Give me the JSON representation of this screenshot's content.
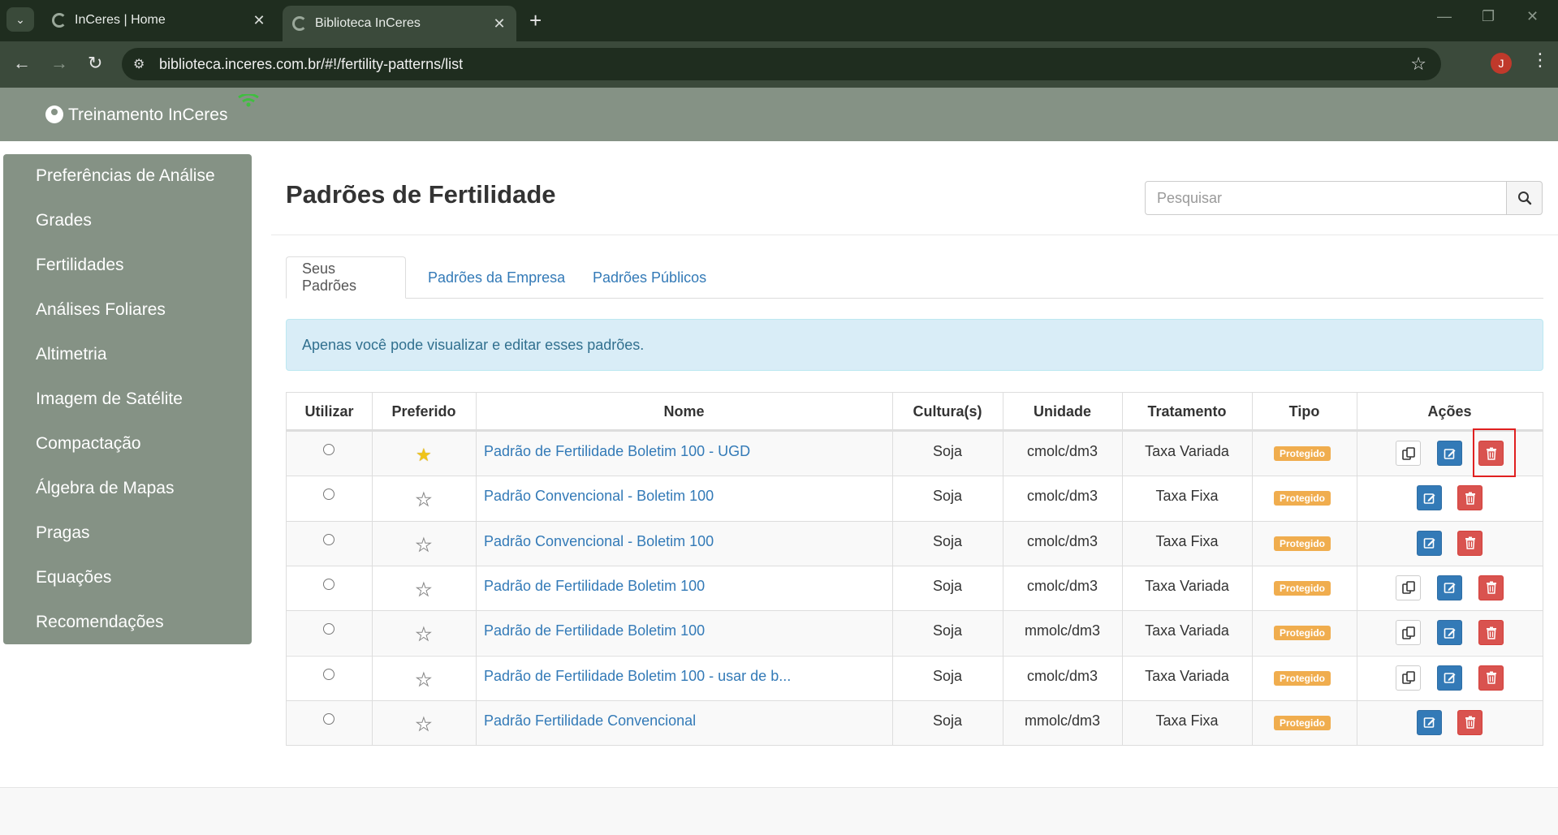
{
  "browser": {
    "tabs": [
      {
        "title": "InCeres | Home",
        "active": false
      },
      {
        "title": "Biblioteca InCeres",
        "active": true
      }
    ],
    "url": "biblioteca.inceres.com.br/#!/fertility-patterns/list",
    "profile_initial": "J",
    "minimize": "—",
    "restore": "❐",
    "close": "✕"
  },
  "header": {
    "user": "Treinamento InCeres"
  },
  "sidebar": {
    "items": [
      {
        "label": "Preferências de Análise"
      },
      {
        "label": "Grades"
      },
      {
        "label": "Fertilidades"
      },
      {
        "label": "Análises Foliares"
      },
      {
        "label": "Altimetria"
      },
      {
        "label": "Imagem de Satélite"
      },
      {
        "label": "Compactação"
      },
      {
        "label": "Álgebra de Mapas"
      },
      {
        "label": "Pragas"
      },
      {
        "label": "Equações"
      },
      {
        "label": "Recomendações"
      }
    ]
  },
  "main": {
    "title": "Padrões de Fertilidade",
    "search_placeholder": "Pesquisar",
    "tabs": [
      {
        "label": "Seus Padrões",
        "active": true
      },
      {
        "label": "Padrões da Empresa",
        "active": false
      },
      {
        "label": "Padrões Públicos",
        "active": false
      }
    ],
    "alert": "Apenas você pode visualizar e editar esses padrões."
  },
  "table": {
    "columns": [
      "Utilizar",
      "Preferido",
      "Nome",
      "Cultura(s)",
      "Unidade",
      "Tratamento",
      "Tipo",
      "Ações"
    ],
    "rows": [
      {
        "name": "Padrão de Fertilidade Boletim 100 - UGD",
        "culture": "Soja",
        "unit": "cmolc/dm3",
        "treatment": "Taxa Variada",
        "type": "Protegido",
        "preferred": true,
        "copy": true
      },
      {
        "name": "Padrão Convencional - Boletim 100",
        "culture": "Soja",
        "unit": "cmolc/dm3",
        "treatment": "Taxa Fixa",
        "type": "Protegido",
        "preferred": false,
        "copy": false
      },
      {
        "name": "Padrão Convencional - Boletim 100",
        "culture": "Soja",
        "unit": "cmolc/dm3",
        "treatment": "Taxa Fixa",
        "type": "Protegido",
        "preferred": false,
        "copy": false
      },
      {
        "name": "Padrão de Fertilidade Boletim 100",
        "culture": "Soja",
        "unit": "cmolc/dm3",
        "treatment": "Taxa Variada",
        "type": "Protegido",
        "preferred": false,
        "copy": true
      },
      {
        "name": "Padrão de Fertilidade Boletim 100",
        "culture": "Soja",
        "unit": "mmolc/dm3",
        "treatment": "Taxa Variada",
        "type": "Protegido",
        "preferred": false,
        "copy": true
      },
      {
        "name": "Padrão de Fertilidade Boletim 100 - usar de b...",
        "culture": "Soja",
        "unit": "cmolc/dm3",
        "treatment": "Taxa Variada",
        "type": "Protegido",
        "preferred": false,
        "copy": true
      },
      {
        "name": "Padrão Fertilidade Convencional",
        "culture": "Soja",
        "unit": "mmolc/dm3",
        "treatment": "Taxa Fixa",
        "type": "Protegido",
        "preferred": false,
        "copy": false
      }
    ]
  },
  "colors": {
    "sidebar_bg": "#859285",
    "header_bg": "#859285",
    "badge": "#f0ad4e",
    "edit_btn": "#337ab7",
    "delete_btn": "#d9534f",
    "link": "#337ab7",
    "highlight": "#e02020"
  },
  "icons": {
    "copy": "copy-icon",
    "edit": "edit-icon",
    "delete": "trash-icon",
    "preferred_on": "star-filled-icon",
    "preferred_off": "star-outline-icon",
    "search": "search-icon"
  }
}
